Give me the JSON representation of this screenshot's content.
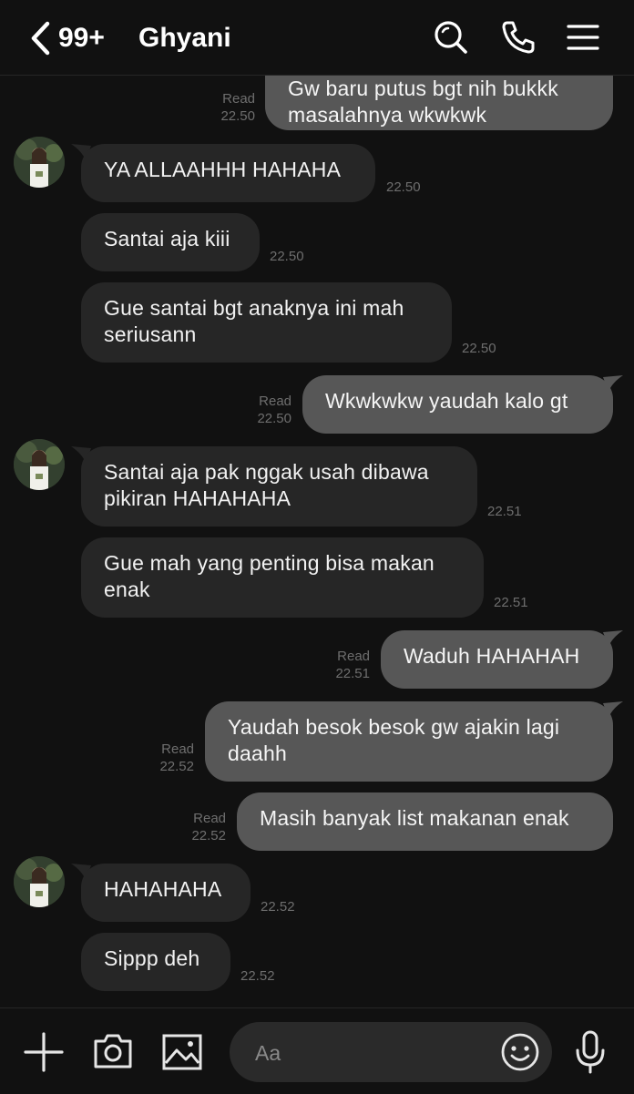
{
  "header": {
    "unread_count": "99+",
    "contact_name": "Ghyani",
    "icons": [
      "back-chevron-icon",
      "search-icon",
      "phone-icon",
      "menu-icon"
    ]
  },
  "messages": [
    {
      "side": "out",
      "text": "Gw baru putus bgt nih bukkk\nmasalahnya wkwkwk",
      "read": "Read",
      "time": "22.50"
    },
    {
      "side": "in",
      "text": "YA ALLAAHHH HAHAHA",
      "time": "22.50"
    },
    {
      "side": "in",
      "text": "Santai aja kiii",
      "time": "22.50"
    },
    {
      "side": "in",
      "text": "Gue santai bgt anaknya ini mah\nseriusann",
      "time": "22.50"
    },
    {
      "side": "out",
      "text": "Wkwkwkw yaudah kalo gt",
      "read": "Read",
      "time": "22.50"
    },
    {
      "side": "in",
      "text": "Santai aja pak nggak usah dibawa\npikiran HAHAHAHA",
      "time": "22.51"
    },
    {
      "side": "in",
      "text": "Gue mah yang penting bisa makan\nenak",
      "time": "22.51"
    },
    {
      "side": "out",
      "text": "Waduh HAHAHAH",
      "read": "Read",
      "time": "22.51"
    },
    {
      "side": "out",
      "text": "Yaudah besok besok gw ajakin lagi\ndaahh",
      "read": "Read",
      "time": "22.52"
    },
    {
      "side": "out",
      "text": "Masih banyak list makanan enak",
      "read": "Read",
      "time": "22.52"
    },
    {
      "side": "in",
      "text": "HAHAHAHA",
      "time": "22.52"
    },
    {
      "side": "in",
      "text": "Sippp deh",
      "time": "22.52"
    }
  ],
  "composer": {
    "placeholder": "Aa",
    "icons": [
      "plus-icon",
      "camera-icon",
      "image-icon",
      "emoji-icon",
      "microphone-icon"
    ]
  },
  "colors": {
    "background": "#111111",
    "incoming_bubble": "#262626",
    "outgoing_bubble": "#575757",
    "timestamp": "#6e6e6e"
  }
}
